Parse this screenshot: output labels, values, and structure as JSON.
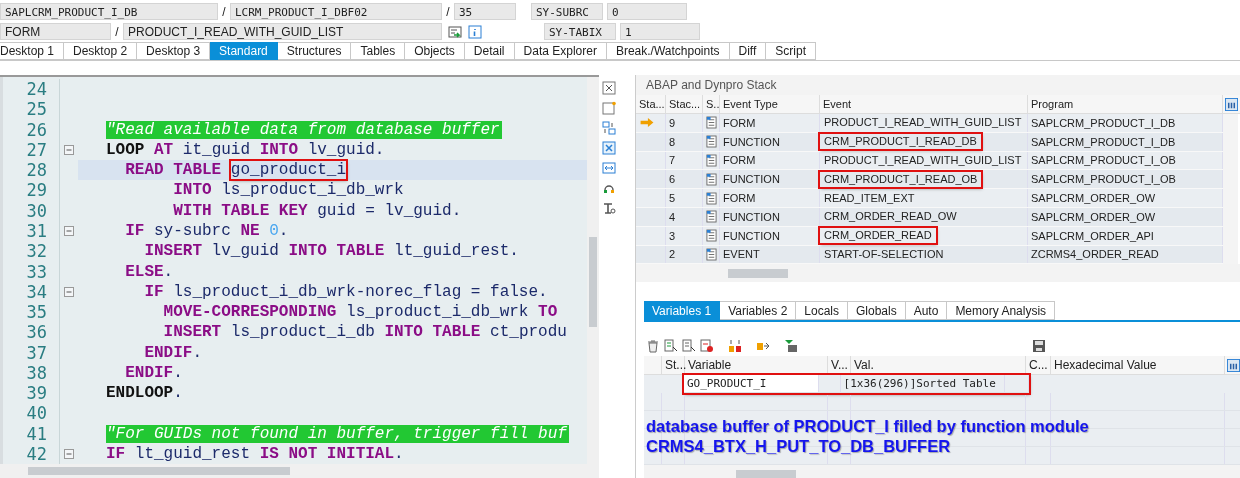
{
  "header": {
    "program": "SAPLCRM_PRODUCT_I_DB",
    "include": "LCRM_PRODUCT_I_DBF02",
    "line": "35",
    "event_type": "FORM",
    "event": "PRODUCT_I_READ_WITH_GUID_LIST",
    "separators": [
      "/",
      "/",
      "/"
    ],
    "sysvars": [
      {
        "name": "SY-SUBRC",
        "value": "0"
      },
      {
        "name": "SY-TABIX",
        "value": "1"
      }
    ]
  },
  "tabs": [
    {
      "label": "Desktop 1",
      "selected": false
    },
    {
      "label": "Desktop 2",
      "selected": false
    },
    {
      "label": "Desktop 3",
      "selected": false
    },
    {
      "label": "Standard",
      "selected": true
    },
    {
      "label": "Structures",
      "selected": false
    },
    {
      "label": "Tables",
      "selected": false
    },
    {
      "label": "Objects",
      "selected": false
    },
    {
      "label": "Detail",
      "selected": false
    },
    {
      "label": "Data Explorer",
      "selected": false
    },
    {
      "label": "Break./Watchpoints",
      "selected": false
    },
    {
      "label": "Diff",
      "selected": false
    },
    {
      "label": "Script",
      "selected": false
    }
  ],
  "editor": {
    "lines": [
      {
        "number": "24",
        "current": false,
        "fold": false
      },
      {
        "number": "25",
        "current": false,
        "fold": false
      },
      {
        "number": "26",
        "current": false,
        "fold": false,
        "tokens": [
          {
            "kind": "comment",
            "text": "\"Read available data from database buffer"
          }
        ]
      },
      {
        "number": "27",
        "current": false,
        "fold": true,
        "tokens": [
          {
            "kind": "kwb",
            "text": "LOOP"
          },
          {
            "kind": "kw",
            "text": " AT"
          },
          {
            "kind": "id",
            "text": " it_guid"
          },
          {
            "kind": "kw",
            "text": " INTO"
          },
          {
            "kind": "id",
            "text": " lv_guid."
          }
        ]
      },
      {
        "number": "28",
        "current": true,
        "fold": false,
        "tokens": [
          {
            "kind": "kw",
            "text": "  READ TABLE "
          },
          {
            "kind": "id",
            "text": "go_product_i",
            "boxed": true
          }
        ]
      },
      {
        "number": "29",
        "current": false,
        "fold": false,
        "tokens": [
          {
            "kind": "kw",
            "text": "       INTO"
          },
          {
            "kind": "id",
            "text": " ls_product_i_db_wrk"
          }
        ]
      },
      {
        "number": "30",
        "current": false,
        "fold": false,
        "tokens": [
          {
            "kind": "kw",
            "text": "       WITH TABLE KEY"
          },
          {
            "kind": "id",
            "text": " guid = lv_guid."
          }
        ]
      },
      {
        "number": "31",
        "current": false,
        "fold": true,
        "tokens": [
          {
            "kind": "kw",
            "text": "  IF"
          },
          {
            "kind": "id",
            "text": " sy-subrc"
          },
          {
            "kind": "kw",
            "text": " NE"
          },
          {
            "kind": "num",
            "text": " 0"
          },
          {
            "kind": "id",
            "text": "."
          }
        ]
      },
      {
        "number": "32",
        "current": false,
        "fold": false,
        "tokens": [
          {
            "kind": "kw",
            "text": "    INSERT"
          },
          {
            "kind": "id",
            "text": " lv_guid"
          },
          {
            "kind": "kw",
            "text": " INTO TABLE"
          },
          {
            "kind": "id",
            "text": " lt_guid_rest."
          }
        ]
      },
      {
        "number": "33",
        "current": false,
        "fold": false,
        "tokens": [
          {
            "kind": "kw",
            "text": "  ELSE"
          },
          {
            "kind": "id",
            "text": "."
          }
        ]
      },
      {
        "number": "34",
        "current": false,
        "fold": true,
        "tokens": [
          {
            "kind": "kw",
            "text": "    IF"
          },
          {
            "kind": "id",
            "text": " ls_product_i_db_wrk-norec_flag = false."
          }
        ]
      },
      {
        "number": "35",
        "current": false,
        "fold": false,
        "tokens": [
          {
            "kind": "kw",
            "text": "      MOVE-CORRESPONDING"
          },
          {
            "kind": "id",
            "text": " ls_product_i_db_wrk"
          },
          {
            "kind": "kw",
            "text": " TO"
          }
        ]
      },
      {
        "number": "36",
        "current": false,
        "fold": false,
        "tokens": [
          {
            "kind": "kw",
            "text": "      INSERT"
          },
          {
            "kind": "id",
            "text": " ls_product_i_db"
          },
          {
            "kind": "kw",
            "text": " INTO TABLE"
          },
          {
            "kind": "id",
            "text": " ct_produ"
          }
        ]
      },
      {
        "number": "37",
        "current": false,
        "fold": false,
        "tokens": [
          {
            "kind": "kw",
            "text": "    ENDIF"
          },
          {
            "kind": "id",
            "text": "."
          }
        ]
      },
      {
        "number": "38",
        "current": false,
        "fold": false,
        "tokens": [
          {
            "kind": "kw",
            "text": "  ENDIF"
          },
          {
            "kind": "id",
            "text": "."
          }
        ]
      },
      {
        "number": "39",
        "current": false,
        "fold": false,
        "tokens": [
          {
            "kind": "kwb",
            "text": "ENDLOOP"
          },
          {
            "kind": "id",
            "text": "."
          }
        ]
      },
      {
        "number": "40",
        "current": false,
        "fold": false
      },
      {
        "number": "41",
        "current": false,
        "fold": false,
        "tokens": [
          {
            "kind": "comment",
            "text": "\"For GUIDs not found in buffer, trigger fill buf"
          }
        ]
      },
      {
        "number": "42",
        "current": false,
        "fold": true,
        "tokens": [
          {
            "kind": "kw",
            "text": "IF"
          },
          {
            "kind": "id",
            "text": " lt_guid_rest"
          },
          {
            "kind": "kw",
            "text": " IS NOT INITIAL"
          },
          {
            "kind": "id",
            "text": "."
          }
        ]
      }
    ]
  },
  "stack": {
    "title": "ABAP and Dynpro Stack",
    "columns": [
      "Sta...",
      "Stac...",
      "S..",
      "Event Type",
      "Event",
      "Program"
    ],
    "rows": [
      {
        "level": "9",
        "current": true,
        "event_type": "FORM",
        "event": "PRODUCT_I_READ_WITH_GUID_LIST",
        "boxed": false,
        "program": "SAPLCRM_PRODUCT_I_DB"
      },
      {
        "level": "8",
        "current": false,
        "event_type": "FUNCTION",
        "event": "CRM_PRODUCT_I_READ_DB",
        "boxed": true,
        "program": "SAPLCRM_PRODUCT_I_DB"
      },
      {
        "level": "7",
        "current": false,
        "event_type": "FORM",
        "event": "PRODUCT_I_READ_WITH_GUID_LIST",
        "boxed": false,
        "program": "SAPLCRM_PRODUCT_I_OB"
      },
      {
        "level": "6",
        "current": false,
        "event_type": "FUNCTION",
        "event": "CRM_PRODUCT_I_READ_OB",
        "boxed": true,
        "program": "SAPLCRM_PRODUCT_I_OB"
      },
      {
        "level": "5",
        "current": false,
        "event_type": "FORM",
        "event": "READ_ITEM_EXT",
        "boxed": false,
        "program": "SAPLCRM_ORDER_OW"
      },
      {
        "level": "4",
        "current": false,
        "event_type": "FUNCTION",
        "event": "CRM_ORDER_READ_OW",
        "boxed": false,
        "program": "SAPLCRM_ORDER_OW"
      },
      {
        "level": "3",
        "current": false,
        "event_type": "FUNCTION",
        "event": "CRM_ORDER_READ",
        "boxed": true,
        "program": "SAPLCRM_ORDER_API"
      },
      {
        "level": "2",
        "current": false,
        "event_type": "EVENT",
        "event": "START-OF-SELECTION",
        "boxed": false,
        "program": "ZCRMS4_ORDER_READ"
      }
    ]
  },
  "variables": {
    "tabs": [
      {
        "label": "Variables 1",
        "selected": true
      },
      {
        "label": "Variables 2",
        "selected": false
      },
      {
        "label": "Locals",
        "selected": false
      },
      {
        "label": "Globals",
        "selected": false
      },
      {
        "label": "Auto",
        "selected": false
      },
      {
        "label": "Memory Analysis",
        "selected": false
      }
    ],
    "columns": [
      "St...",
      "Variable",
      "V...",
      "Val.",
      "C...",
      "Hexadecimal Value"
    ],
    "rows": [
      {
        "variable": "GO_PRODUCT_I",
        "value": "[1x36(296)]Sorted Table",
        "boxed": true
      }
    ],
    "note": [
      "database buffer of PRODUCT_I filled by function module",
      "CRMS4_BTX_H_PUT_TO_DB_BUFFER"
    ]
  }
}
